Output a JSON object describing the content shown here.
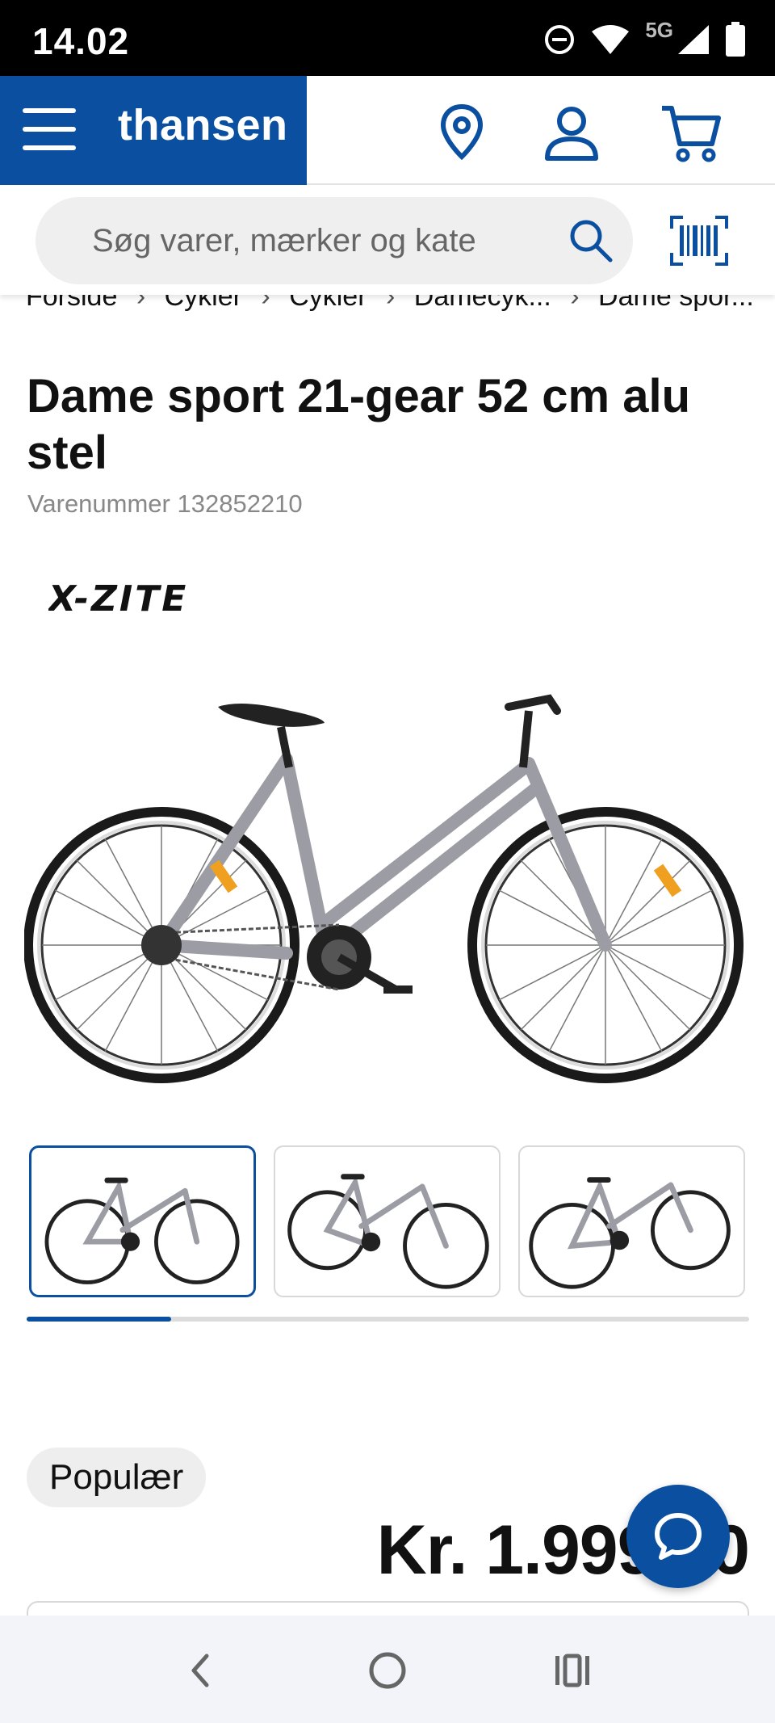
{
  "status_bar": {
    "time": "14.02",
    "network": "5G"
  },
  "header": {
    "logo": "thansen",
    "brand_color": "#0b4fa0",
    "icons": [
      "menu-icon",
      "location-pin-icon",
      "user-icon",
      "cart-icon"
    ]
  },
  "search": {
    "placeholder": "Søg varer, mærker og kate"
  },
  "breadcrumb": {
    "items": [
      "Forside",
      "Cykler",
      "Cykler",
      "Damecyk...",
      "Dame spor..."
    ],
    "separator": "›"
  },
  "product": {
    "title": "Dame sport 21-gear 52 cm alu stel",
    "sku_label": "Varenummer 132852210",
    "brand_logo": "X-ZITE",
    "badge": "Populær",
    "price": "Kr. 1.999,00"
  },
  "gallery": {
    "thumbnail_count": 3,
    "active_index": 0,
    "progress": 0.2
  },
  "navbar": {
    "icons": [
      "back-icon",
      "home-icon",
      "recents-icon"
    ]
  }
}
